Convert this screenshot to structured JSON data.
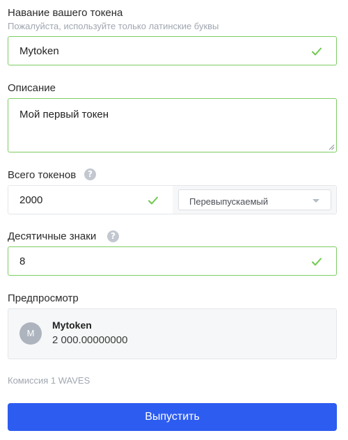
{
  "token_name": {
    "label": "Навание вашего токена",
    "hint": "Пожалуйста, используйте только латинские буквы",
    "value": "Mytoken",
    "status_icon": "check-icon"
  },
  "description": {
    "label": "Описание",
    "value": "Мой первый токен"
  },
  "total_tokens": {
    "label": "Всего токенов",
    "help": "?",
    "value": "2000",
    "status_icon": "check-icon",
    "reissue_select": {
      "selected": "Перевыпускаемый"
    }
  },
  "decimals": {
    "label": "Десятичные знаки",
    "help": "?",
    "value": "8",
    "status_icon": "check-icon"
  },
  "preview": {
    "label": "Предпросмотр",
    "avatar_letter": "M",
    "name": "Mytoken",
    "amount": "2 000.00000000"
  },
  "fee_text": "Комиссия 1 WAVES",
  "submit_label": "Выпустить",
  "colors": {
    "valid_border": "#7dcc63",
    "check": "#6cc94d",
    "primary": "#2d5cf0"
  }
}
